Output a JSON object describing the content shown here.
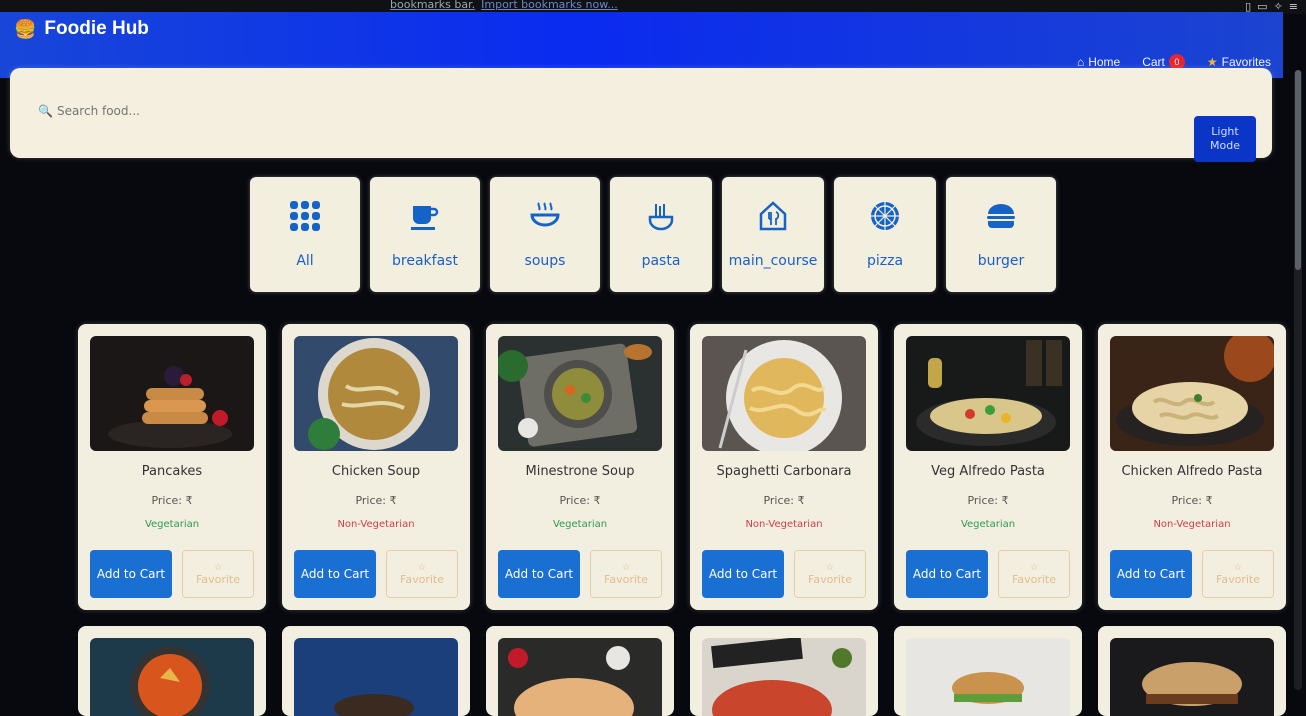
{
  "browser": {
    "bookmarks_prefix": "bookmarks bar.",
    "import_link": "Import bookmarks now...",
    "window_icons": [
      "sidebar-icon",
      "tabs-icon",
      "sparkle-icon",
      "menu-icon"
    ]
  },
  "header": {
    "brand": "Foodie Hub",
    "nav": {
      "home": "Home",
      "cart": "Cart",
      "cart_count": "0",
      "favorites": "Favorites"
    }
  },
  "toolbar": {
    "search_placeholder": "Search food...",
    "mode_button": "Light Mode"
  },
  "categories": [
    {
      "label": "All",
      "icon": "grid-icon"
    },
    {
      "label": "breakfast",
      "icon": "mug-icon"
    },
    {
      "label": "soups",
      "icon": "bowl-icon"
    },
    {
      "label": "pasta",
      "icon": "noodles-icon"
    },
    {
      "label": "main_course",
      "icon": "house-icon"
    },
    {
      "label": "pizza",
      "icon": "pizza-icon"
    },
    {
      "label": "burger",
      "icon": "burger-icon"
    }
  ],
  "products": [
    {
      "name": "Pancakes",
      "price": "Price: ₹",
      "type": "Vegetarian",
      "veg": true
    },
    {
      "name": "Chicken Soup",
      "price": "Price: ₹",
      "type": "Non-Vegetarian",
      "veg": false
    },
    {
      "name": "Minestrone Soup",
      "price": "Price: ₹",
      "type": "Vegetarian",
      "veg": true
    },
    {
      "name": "Spaghetti Carbonara",
      "price": "Price: ₹",
      "type": "Non-Vegetarian",
      "veg": false
    },
    {
      "name": "Veg Alfredo Pasta",
      "price": "Price: ₹",
      "type": "Vegetarian",
      "veg": true
    },
    {
      "name": "Chicken Alfredo Pasta",
      "price": "Price: ₹",
      "type": "Non-Vegetarian",
      "veg": false
    }
  ],
  "buttons": {
    "add_to_cart": "Add to Cart",
    "favorite": "Favorite"
  },
  "colors": {
    "header": "#0a2bf0",
    "accent": "#1a6fd3",
    "veg": "#2e9a52",
    "nonveg": "#d2404a",
    "panel": "#f2eee0"
  }
}
